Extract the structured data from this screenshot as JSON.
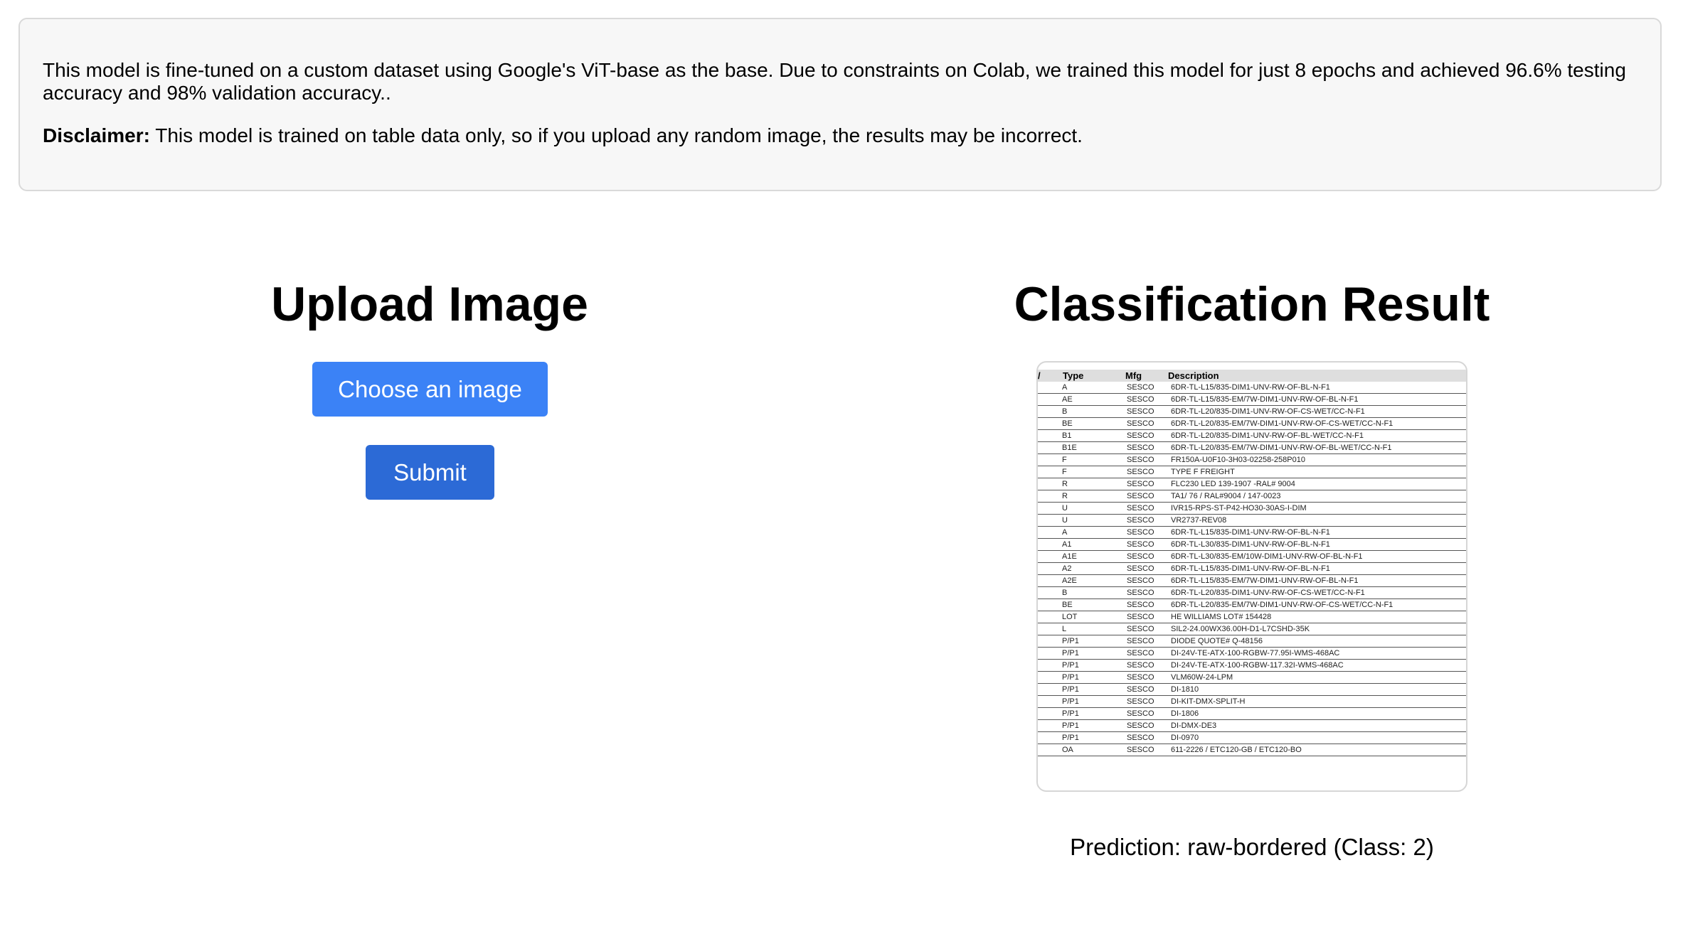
{
  "info": {
    "description": "This model is fine-tuned on a custom dataset using Google's ViT-base as the base. Due to constraints on Colab, we trained this model for just 8 epochs and achieved 96.6% testing accuracy and 98% validation accuracy..",
    "disclaimer_label": "Disclaimer:",
    "disclaimer_text": " This model is trained on table data only, so if you upload any random image, the results may be incorrect."
  },
  "upload": {
    "title": "Upload Image",
    "choose_label": "Choose an image",
    "submit_label": "Submit"
  },
  "result": {
    "title": "Classification Result",
    "prediction": "Prediction: raw-bordered (Class: 2)",
    "preview_table": {
      "headers": [
        "/",
        "Type",
        "Mfg",
        "Description"
      ],
      "rows": [
        [
          "A",
          "SESCO",
          "6DR-TL-L15/835-DIM1-UNV-RW-OF-BL-N-F1"
        ],
        [
          "AE",
          "SESCO",
          "6DR-TL-L15/835-EM/7W-DIM1-UNV-RW-OF-BL-N-F1"
        ],
        [
          "B",
          "SESCO",
          "6DR-TL-L20/835-DIM1-UNV-RW-OF-CS-WET/CC-N-F1"
        ],
        [
          "BE",
          "SESCO",
          "6DR-TL-L20/835-EM/7W-DIM1-UNV-RW-OF-CS-WET/CC-N-F1"
        ],
        [
          "B1",
          "SESCO",
          "6DR-TL-L20/835-DIM1-UNV-RW-OF-BL-WET/CC-N-F1"
        ],
        [
          "B1E",
          "SESCO",
          "6DR-TL-L20/835-EM/7W-DIM1-UNV-RW-OF-BL-WET/CC-N-F1"
        ],
        [
          "F",
          "SESCO",
          "FR150A-U0F10-3H03-02258-258P010"
        ],
        [
          "F",
          "SESCO",
          "TYPE F FREIGHT"
        ],
        [
          "R",
          "SESCO",
          "FLC230 LED 139-1907 -RAL# 9004"
        ],
        [
          "R",
          "SESCO",
          "TA1/ 76 / RAL#9004 / 147-0023"
        ],
        [
          "U",
          "SESCO",
          "IVR15-RPS-ST-P42-HO30-30AS-I-DIM"
        ],
        [
          "U",
          "SESCO",
          "VR2737-REV08"
        ],
        [
          "A",
          "SESCO",
          "6DR-TL-L15/835-DIM1-UNV-RW-OF-BL-N-F1"
        ],
        [
          "A1",
          "SESCO",
          "6DR-TL-L30/835-DIM1-UNV-RW-OF-BL-N-F1"
        ],
        [
          "A1E",
          "SESCO",
          "6DR-TL-L30/835-EM/10W-DIM1-UNV-RW-OF-BL-N-F1"
        ],
        [
          "A2",
          "SESCO",
          "6DR-TL-L15/835-DIM1-UNV-RW-OF-BL-N-F1"
        ],
        [
          "A2E",
          "SESCO",
          "6DR-TL-L15/835-EM/7W-DIM1-UNV-RW-OF-BL-N-F1"
        ],
        [
          "B",
          "SESCO",
          "6DR-TL-L20/835-DIM1-UNV-RW-OF-CS-WET/CC-N-F1"
        ],
        [
          "BE",
          "SESCO",
          "6DR-TL-L20/835-EM/7W-DIM1-UNV-RW-OF-CS-WET/CC-N-F1"
        ],
        [
          "LOT",
          "SESCO",
          "HE WILLIAMS LOT# 154428"
        ],
        [
          "L",
          "SESCO",
          "SIL2-24.00WX36.00H-D1-L7CSHD-35K"
        ],
        [
          "P/P1",
          "SESCO",
          "DIODE QUOTE# Q-48156"
        ],
        [
          "P/P1",
          "SESCO",
          "DI-24V-TE-ATX-100-RGBW-77.95I-WMS-468AC"
        ],
        [
          "P/P1",
          "SESCO",
          "DI-24V-TE-ATX-100-RGBW-117.32I-WMS-468AC"
        ],
        [
          "P/P1",
          "SESCO",
          "VLM60W-24-LPM"
        ],
        [
          "P/P1",
          "SESCO",
          "DI-1810"
        ],
        [
          "P/P1",
          "SESCO",
          "DI-KIT-DMX-SPLIT-H"
        ],
        [
          "P/P1",
          "SESCO",
          "DI-1806"
        ],
        [
          "P/P1",
          "SESCO",
          "DI-DMX-DE3"
        ],
        [
          "P/P1",
          "SESCO",
          "DI-0970"
        ],
        [
          "OA",
          "SESCO",
          "611-2226 / ETC120-GB / ETC120-BO"
        ]
      ]
    }
  }
}
